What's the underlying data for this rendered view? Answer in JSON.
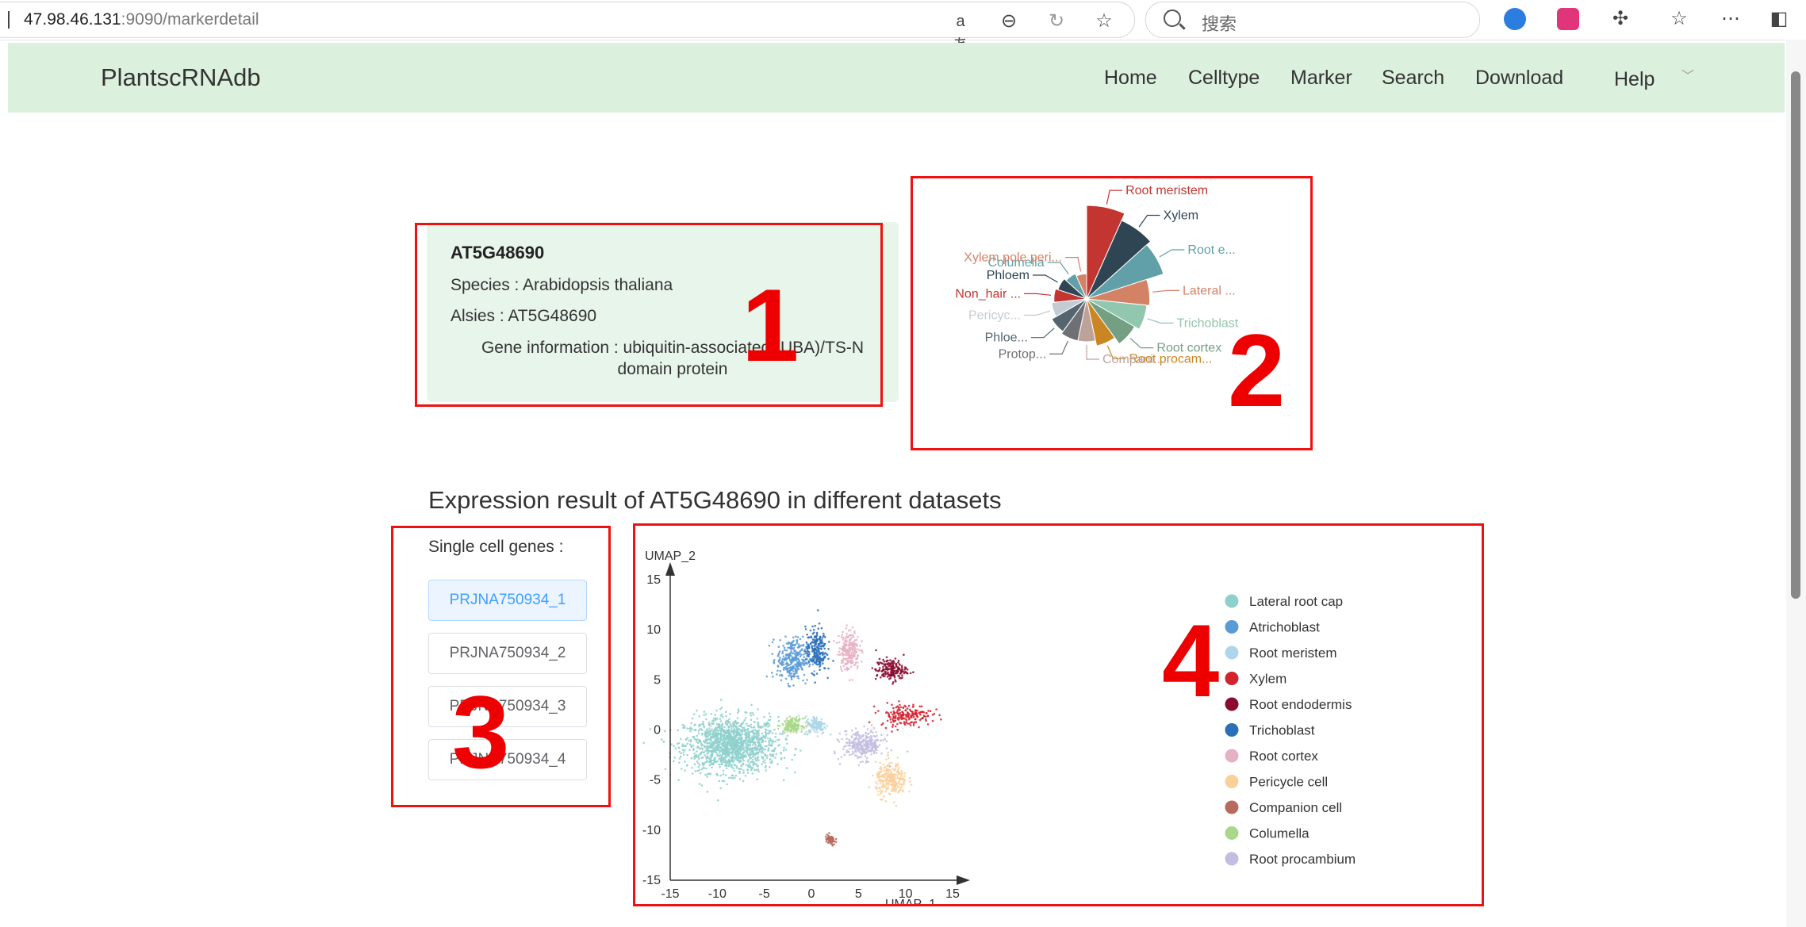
{
  "browser": {
    "url_host": "47.98.46.131",
    "url_rest": ":9090/markerdetail",
    "search_placeholder": "搜索"
  },
  "nav": {
    "brand": "PlantscRNAdb",
    "items": [
      "Home",
      "Celltype",
      "Marker",
      "Search",
      "Download",
      "Help"
    ]
  },
  "gene": {
    "id": "AT5G48690",
    "species": "Species : Arabidopsis thaliana",
    "alias": "Alsies : AT5G48690",
    "info_line1": "Gene information : ubiquitin-associated (UBA)/TS-N",
    "info_line2": "domain protein"
  },
  "annotations": [
    "1",
    "2",
    "3",
    "4"
  ],
  "expression": {
    "title": "Expression result of AT5G48690 in different datasets",
    "single_cell_label": "Single cell genes :",
    "datasets": [
      "PRJNA750934_1",
      "PRJNA750934_2",
      "PRJNA750934_3",
      "PRJNA750934_4"
    ],
    "active_dataset": "PRJNA750934_1"
  },
  "chart_data": [
    {
      "type": "pie",
      "variant": "rose",
      "slices": [
        {
          "label": "Root meristem",
          "value": 30,
          "color": "#c23531"
        },
        {
          "label": "Xylem",
          "value": 27,
          "color": "#2f4554"
        },
        {
          "label": "Root e...",
          "value": 25,
          "color": "#61a0a8"
        },
        {
          "label": "Lateral ...",
          "value": 18,
          "color": "#d48265"
        },
        {
          "label": "Trichoblast",
          "value": 17,
          "color": "#91c7ae"
        },
        {
          "label": "Root cortex",
          "value": 15,
          "color": "#749f83"
        },
        {
          "label": "Root procam...",
          "value": 12,
          "color": "#ca8622"
        },
        {
          "label": "Compani...",
          "value": 10,
          "color": "#bda29a"
        },
        {
          "label": "Protop...",
          "value": 10,
          "color": "#6e7074"
        },
        {
          "label": "Phloe...",
          "value": 9,
          "color": "#546570"
        },
        {
          "label": "Pericyc...",
          "value": 7,
          "color": "#c4ccd3"
        },
        {
          "label": "Non_hair ...",
          "value": 6,
          "color": "#c23531"
        },
        {
          "label": "Phloem",
          "value": 5,
          "color": "#2f4554"
        },
        {
          "label": "Columella",
          "value": 4,
          "color": "#61a0a8"
        },
        {
          "label": "Xylem pole peri...",
          "value": 3,
          "color": "#d48265"
        }
      ]
    },
    {
      "type": "scatter",
      "xlabel": "UMAP_1",
      "ylabel": "UMAP_2",
      "xlim": [
        -15,
        15
      ],
      "ylim": [
        -15,
        15
      ],
      "x_ticks": [
        -15,
        -10,
        -5,
        0,
        5,
        10,
        15
      ],
      "y_ticks": [
        15,
        10,
        5,
        0,
        -5,
        -10,
        -15
      ],
      "series": [
        {
          "name": "Lateral root cap",
          "color": "#8ed0cc",
          "center": [
            -8.5,
            -1.5
          ],
          "spread": [
            4.5,
            2.5
          ]
        },
        {
          "name": "Atrichoblast",
          "color": "#5b9bd5",
          "center": [
            -2,
            7
          ],
          "spread": [
            1.5,
            2
          ]
        },
        {
          "name": "Root meristem",
          "color": "#add6ea",
          "center": [
            0.5,
            0.5
          ],
          "spread": [
            1,
            0.8
          ]
        },
        {
          "name": "Xylem",
          "color": "#d2222e",
          "center": [
            10,
            1.5
          ],
          "spread": [
            2.5,
            1
          ]
        },
        {
          "name": "Root endodermis",
          "color": "#8b0a2f",
          "center": [
            8.5,
            6
          ],
          "spread": [
            1.5,
            1
          ]
        },
        {
          "name": "Trichoblast",
          "color": "#2a6fb8",
          "center": [
            0.5,
            8
          ],
          "spread": [
            1,
            2
          ]
        },
        {
          "name": "Root cortex",
          "color": "#e6b1c4",
          "center": [
            4,
            8
          ],
          "spread": [
            1,
            1.8
          ]
        },
        {
          "name": "Pericycle cell",
          "color": "#fbcf9a",
          "center": [
            8.5,
            -5
          ],
          "spread": [
            1.5,
            1.5
          ]
        },
        {
          "name": "Companion cell",
          "color": "#b86a5e",
          "center": [
            2,
            -11
          ],
          "spread": [
            0.5,
            0.5
          ]
        },
        {
          "name": "Columella",
          "color": "#a8d88a",
          "center": [
            -2,
            0.5
          ],
          "spread": [
            1,
            0.6
          ]
        },
        {
          "name": "Root procambium",
          "color": "#c3bde0",
          "center": [
            5.5,
            -1.5
          ],
          "spread": [
            2,
            1.3
          ]
        }
      ]
    }
  ]
}
